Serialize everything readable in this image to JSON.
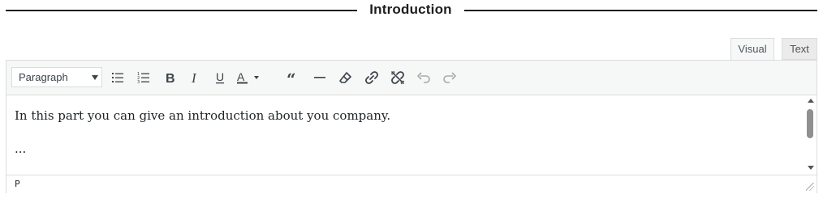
{
  "section": {
    "title": "Introduction"
  },
  "editor": {
    "tabs": [
      {
        "label": "Visual"
      },
      {
        "label": "Text"
      }
    ],
    "toolbar": {
      "format_select_value": "Paragraph",
      "buttons": [
        {
          "name": "bulleted-list",
          "icon": "bulleted-list-icon"
        },
        {
          "name": "numbered-list",
          "icon": "numbered-list-icon"
        },
        {
          "name": "bold",
          "icon": "bold-icon"
        },
        {
          "name": "italic",
          "icon": "italic-icon"
        },
        {
          "name": "underline",
          "icon": "underline-icon"
        },
        {
          "name": "text-color",
          "icon": "text-color-icon"
        },
        {
          "name": "blockquote",
          "icon": "quote-icon"
        },
        {
          "name": "horizontal-line",
          "icon": "horizontal-line-icon"
        },
        {
          "name": "clear-formatting",
          "icon": "eraser-icon"
        },
        {
          "name": "insert-link",
          "icon": "link-icon"
        },
        {
          "name": "remove-link",
          "icon": "unlink-icon"
        },
        {
          "name": "undo",
          "icon": "undo-icon"
        },
        {
          "name": "redo",
          "icon": "redo-icon"
        }
      ]
    },
    "content": {
      "paragraph_1": "In this part you can give an introduction about you company.",
      "paragraph_2": "..."
    },
    "status_path": "P"
  }
}
